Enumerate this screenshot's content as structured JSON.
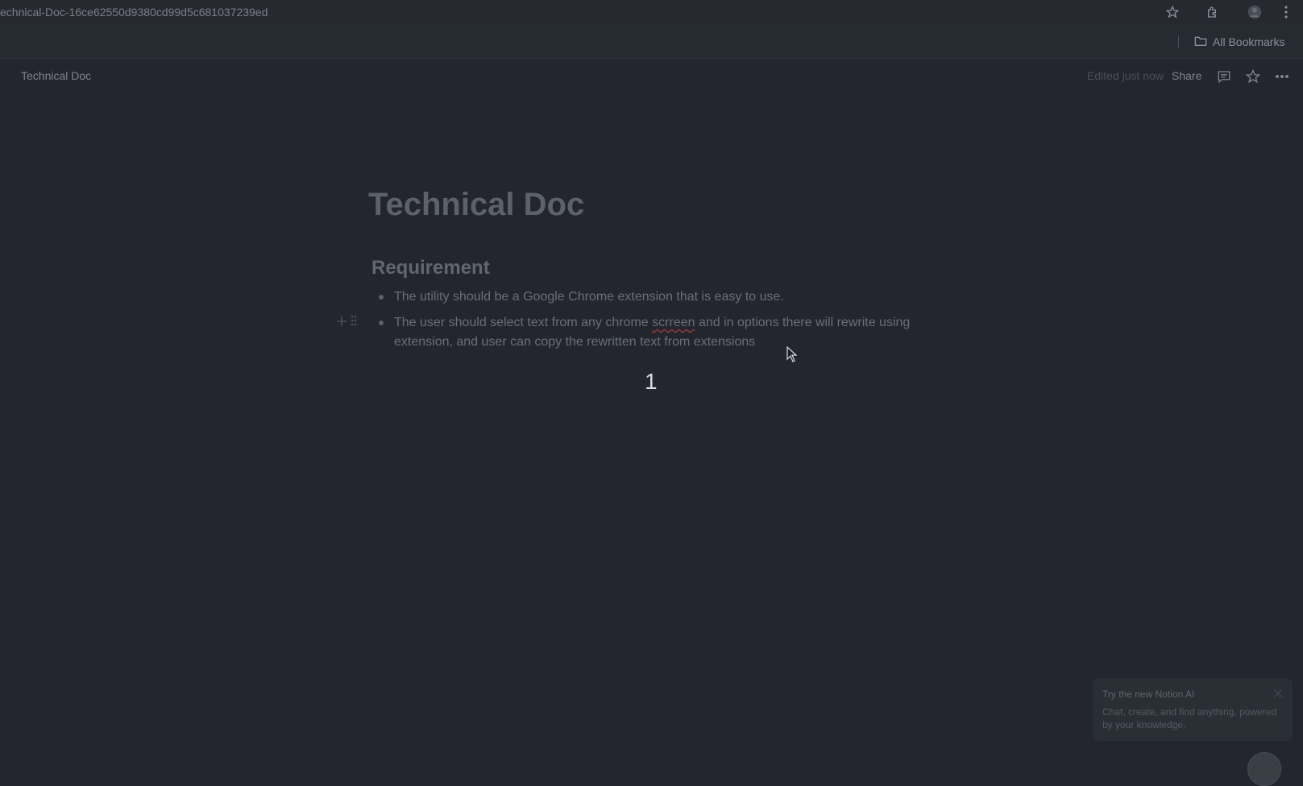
{
  "browser": {
    "url": "echnical-Doc-16ce62550d9380cd99d5c681037239ed",
    "bookmarks_label": "All Bookmarks"
  },
  "topbar": {
    "breadcrumb": "Technical Doc",
    "edited": "Edited just now",
    "share": "Share"
  },
  "page": {
    "title": "Technical Doc",
    "heading": "Requirement",
    "items": [
      {
        "text": "The utility should be a Google Chrome extension that is easy to use."
      },
      {
        "line1_before": "The user should select text from any chrome ",
        "line1_misspelled": "scrreen",
        "line1_after": " and in options there will rewrite using",
        "line2": "extension, and user can copy the rewritten text from extensions"
      }
    ],
    "page_number": "1"
  },
  "ai_popup": {
    "title": "Try the new Notion AI",
    "body": "Chat, create, and find anything, powered by your knowledge."
  }
}
